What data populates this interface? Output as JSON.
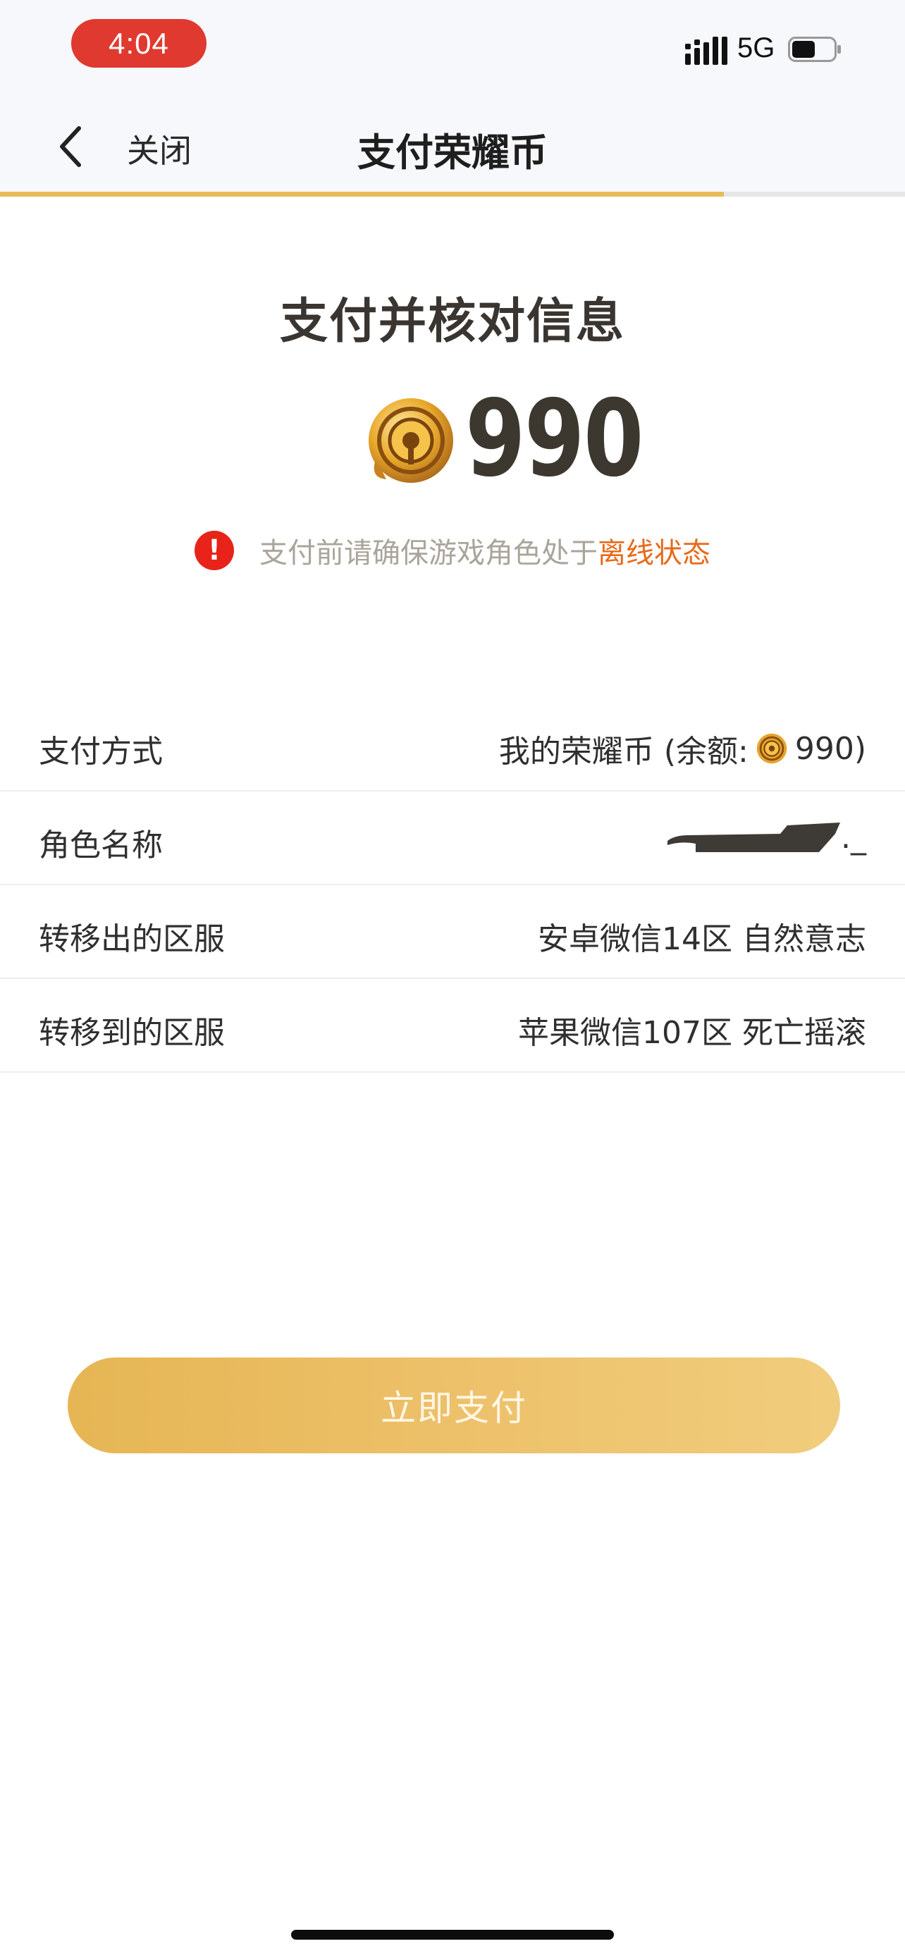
{
  "status_bar": {
    "time": "4:04",
    "network": "5G",
    "battery_level": 0.55
  },
  "nav": {
    "close_label": "关闭",
    "title": "支付荣耀币",
    "progress": 0.8
  },
  "payment": {
    "heading": "支付并核对信息",
    "amount": "990",
    "warning_text": "支付前请确保游戏角色处于",
    "warning_highlight": "离线状态"
  },
  "details": {
    "method_label": "支付方式",
    "method_value_prefix": "我的荣耀币 (余额:",
    "method_value_amount": "990)",
    "role_label": "角色名称",
    "role_value_suffix": "._",
    "from_server_label": "转移出的区服",
    "from_server_value": "安卓微信14区 自然意志",
    "to_server_label": "转移到的区服",
    "to_server_value": "苹果微信107区 死亡摇滚"
  },
  "pay_button_label": "立即支付",
  "colors": {
    "accent": "#e9bc58",
    "warning": "#e8231a",
    "highlight": "#e86a1a"
  }
}
